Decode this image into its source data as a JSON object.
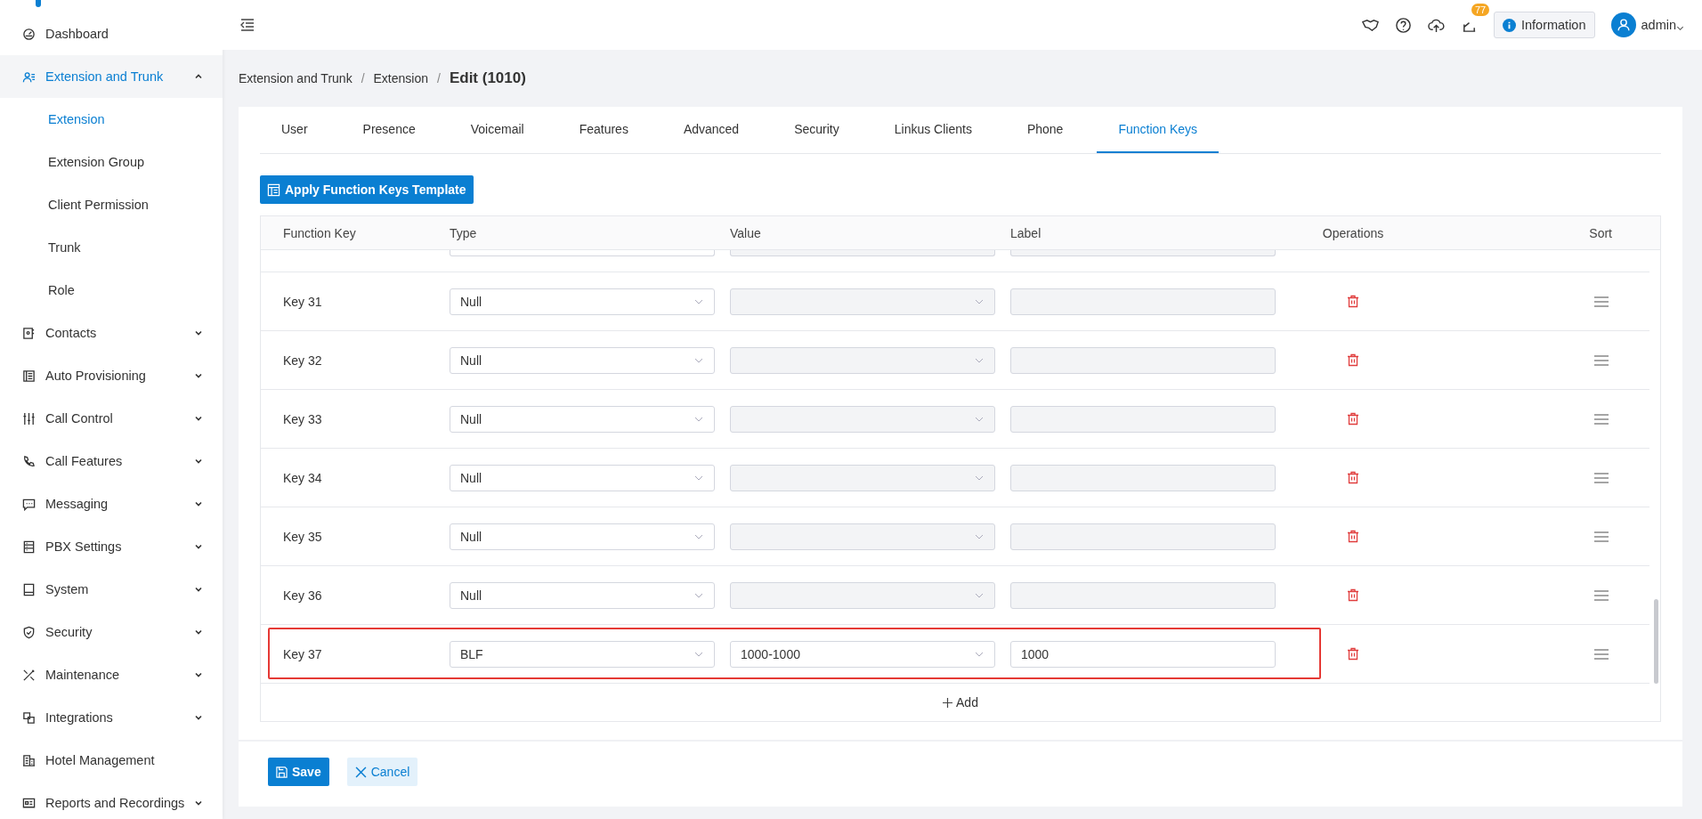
{
  "sidebar": {
    "items": [
      {
        "label": "Dashboard",
        "kind": "link",
        "selected": false
      },
      {
        "label": "Extension and Trunk",
        "kind": "group",
        "expanded": true,
        "selected": true,
        "children": [
          {
            "label": "Extension",
            "selected": true
          },
          {
            "label": "Extension Group",
            "selected": false
          },
          {
            "label": "Client Permission",
            "selected": false
          },
          {
            "label": "Trunk",
            "selected": false
          },
          {
            "label": "Role",
            "selected": false
          }
        ]
      },
      {
        "label": "Contacts",
        "kind": "group",
        "expanded": false,
        "selected": false
      },
      {
        "label": "Auto Provisioning",
        "kind": "group",
        "expanded": false,
        "selected": false
      },
      {
        "label": "Call Control",
        "kind": "group",
        "expanded": false,
        "selected": false
      },
      {
        "label": "Call Features",
        "kind": "group",
        "expanded": false,
        "selected": false
      },
      {
        "label": "Messaging",
        "kind": "group",
        "expanded": false,
        "selected": false
      },
      {
        "label": "PBX Settings",
        "kind": "group",
        "expanded": false,
        "selected": false
      },
      {
        "label": "System",
        "kind": "group",
        "expanded": false,
        "selected": false
      },
      {
        "label": "Security",
        "kind": "group",
        "expanded": false,
        "selected": false
      },
      {
        "label": "Maintenance",
        "kind": "group",
        "expanded": false,
        "selected": false
      },
      {
        "label": "Integrations",
        "kind": "group",
        "expanded": false,
        "selected": false
      },
      {
        "label": "Hotel Management",
        "kind": "link",
        "selected": false
      },
      {
        "label": "Reports and Recordings",
        "kind": "group",
        "expanded": false,
        "selected": false
      }
    ]
  },
  "topbar": {
    "notification_count": "77",
    "info_button": "Information",
    "user": "admin"
  },
  "breadcrumb": [
    {
      "label": "Extension and Trunk",
      "current": false
    },
    {
      "separator": "/",
      "label": "Extension",
      "current": false
    },
    {
      "separator": "/",
      "label": "Edit (1010)",
      "current": true
    }
  ],
  "tabs": [
    {
      "label": "User",
      "selected": false
    },
    {
      "label": "Presence",
      "selected": false
    },
    {
      "label": "Voicemail",
      "selected": false
    },
    {
      "label": "Features",
      "selected": false
    },
    {
      "label": "Advanced",
      "selected": false
    },
    {
      "label": "Security",
      "selected": false
    },
    {
      "label": "Linkus Clients",
      "selected": false
    },
    {
      "label": "Phone",
      "selected": false
    },
    {
      "label": "Function Keys",
      "selected": true
    }
  ],
  "template_button": "Apply Function Keys Template",
  "table": {
    "columns": [
      "Function Key",
      "Type",
      "Value",
      "Label",
      "Operations",
      "Sort"
    ],
    "rows": [
      {
        "key": "Key 31",
        "type": "Null",
        "value": "",
        "label": "",
        "value_disabled": true,
        "highlighted": false
      },
      {
        "key": "Key 32",
        "type": "Null",
        "value": "",
        "label": "",
        "value_disabled": true,
        "highlighted": false
      },
      {
        "key": "Key 33",
        "type": "Null",
        "value": "",
        "label": "",
        "value_disabled": true,
        "highlighted": false
      },
      {
        "key": "Key 34",
        "type": "Null",
        "value": "",
        "label": "",
        "value_disabled": true,
        "highlighted": false
      },
      {
        "key": "Key 35",
        "type": "Null",
        "value": "",
        "label": "",
        "value_disabled": true,
        "highlighted": false
      },
      {
        "key": "Key 36",
        "type": "Null",
        "value": "",
        "label": "",
        "value_disabled": true,
        "highlighted": false
      },
      {
        "key": "Key 37",
        "type": "BLF",
        "value": "1000-1000",
        "label": "1000",
        "value_disabled": false,
        "highlighted": true
      }
    ],
    "add_button": "Add"
  },
  "footer": {
    "save": "Save",
    "cancel": "Cancel"
  }
}
